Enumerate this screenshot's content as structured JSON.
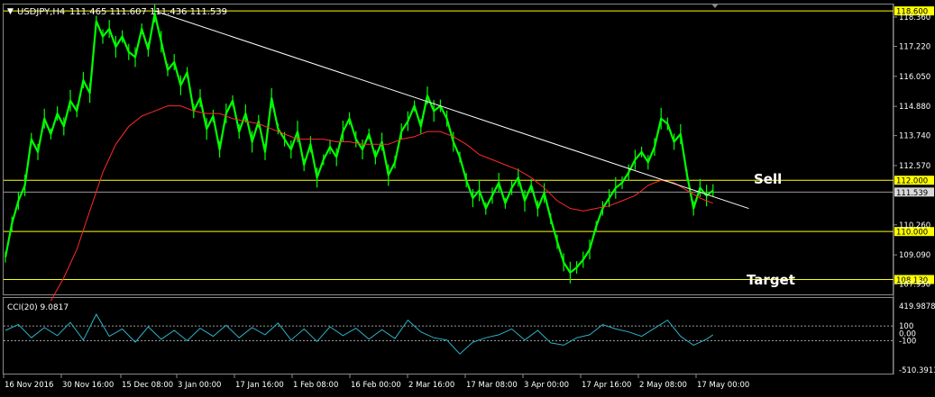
{
  "window": {
    "header_label": "USDJPY,H4",
    "ohlc": "111.465 111.607 111.436 111.539",
    "collapse_glyph": "▼"
  },
  "indicator": {
    "label": "CCI(20) 9.0817",
    "scale_labels": [
      "419.9878",
      "100",
      "0.00",
      "-100",
      "-510.3913"
    ],
    "level_upper": 100,
    "level_lower": -100,
    "range": [
      -510.3913,
      419.9878
    ]
  },
  "annotations": {
    "sell": "Sell",
    "target": "Target"
  },
  "colors": {
    "background": "#000000",
    "price": "#00ff00",
    "ma": "#ff2a2a",
    "trendline": "#ffffff",
    "levels": "#ffff00",
    "cci": "#2bb3c9",
    "grid_text": "#ffffff"
  },
  "chart_data": [
    {
      "type": "line",
      "symbol": "USDJPY",
      "timeframe": "H4",
      "ylim": [
        107.55,
        118.85
      ],
      "y_tick_labels": [
        "118.360",
        "117.220",
        "116.050",
        "114.880",
        "113.740",
        "112.570",
        "111.539",
        "110.260",
        "109.090",
        "107.950"
      ],
      "x_tick_labels": [
        "16 Nov 2016",
        "30 Nov 16:00",
        "15 Dec 08:00",
        "3 Jan 00:00",
        "17 Jan 16:00",
        "1 Feb 08:00",
        "16 Feb 00:00",
        "2 Mar 16:00",
        "17 Mar 08:00",
        "3 Apr 00:00",
        "17 Apr 16:00",
        "2 May 08:00",
        "17 May 00:00"
      ],
      "horizontal_levels": [
        {
          "label": "118.600",
          "value": 118.6
        },
        {
          "label": "112.000",
          "value": 112.0
        },
        {
          "label": "110.000",
          "value": 110.0
        },
        {
          "label": "108.130",
          "value": 108.13
        }
      ],
      "current_price_label": "111.539",
      "current_price": 111.539,
      "series": [
        {
          "points": [
            [
              0,
              109.0
            ],
            [
              2,
              110.3
            ],
            [
              4,
              111.2
            ],
            [
              6,
              111.8
            ],
            [
              8,
              113.6
            ],
            [
              10,
              113.1
            ],
            [
              12,
              114.4
            ],
            [
              14,
              113.8
            ],
            [
              16,
              114.6
            ],
            [
              18,
              114.1
            ],
            [
              20,
              115.1
            ],
            [
              22,
              114.7
            ],
            [
              24,
              115.9
            ],
            [
              26,
              115.4
            ],
            [
              28,
              118.2
            ],
            [
              30,
              117.6
            ],
            [
              32,
              117.9
            ],
            [
              34,
              117.2
            ],
            [
              36,
              117.6
            ],
            [
              38,
              117.0
            ],
            [
              40,
              116.8
            ],
            [
              42,
              117.9
            ],
            [
              44,
              117.1
            ],
            [
              46,
              118.5
            ],
            [
              48,
              117.4
            ],
            [
              50,
              116.3
            ],
            [
              52,
              116.6
            ],
            [
              54,
              115.7
            ],
            [
              56,
              116.2
            ],
            [
              58,
              114.7
            ],
            [
              60,
              115.2
            ],
            [
              62,
              114.0
            ],
            [
              64,
              114.5
            ],
            [
              66,
              113.2
            ],
            [
              68,
              114.6
            ],
            [
              70,
              115.1
            ],
            [
              72,
              113.9
            ],
            [
              74,
              114.6
            ],
            [
              76,
              113.5
            ],
            [
              78,
              114.3
            ],
            [
              80,
              113.1
            ],
            [
              82,
              115.2
            ],
            [
              84,
              114.0
            ],
            [
              86,
              113.6
            ],
            [
              88,
              113.2
            ],
            [
              90,
              113.9
            ],
            [
              92,
              112.6
            ],
            [
              94,
              113.4
            ],
            [
              96,
              112.1
            ],
            [
              98,
              112.8
            ],
            [
              100,
              113.3
            ],
            [
              102,
              112.9
            ],
            [
              104,
              113.9
            ],
            [
              106,
              114.4
            ],
            [
              108,
              113.6
            ],
            [
              110,
              113.2
            ],
            [
              112,
              113.8
            ],
            [
              114,
              112.9
            ],
            [
              116,
              113.5
            ],
            [
              118,
              112.2
            ],
            [
              120,
              112.7
            ],
            [
              122,
              113.9
            ],
            [
              124,
              114.3
            ],
            [
              126,
              114.9
            ],
            [
              128,
              114.1
            ],
            [
              130,
              115.3
            ],
            [
              132,
              114.7
            ],
            [
              134,
              114.9
            ],
            [
              136,
              114.4
            ],
            [
              138,
              113.5
            ],
            [
              140,
              112.9
            ],
            [
              142,
              112.0
            ],
            [
              144,
              111.3
            ],
            [
              146,
              111.6
            ],
            [
              148,
              110.9
            ],
            [
              150,
              111.4
            ],
            [
              152,
              111.9
            ],
            [
              154,
              111.1
            ],
            [
              156,
              111.7
            ],
            [
              158,
              112.1
            ],
            [
              160,
              111.2
            ],
            [
              162,
              111.8
            ],
            [
              164,
              110.9
            ],
            [
              166,
              111.5
            ],
            [
              168,
              110.5
            ],
            [
              170,
              109.6
            ],
            [
              172,
              108.8
            ],
            [
              174,
              108.4
            ],
            [
              176,
              108.6
            ],
            [
              178,
              108.9
            ],
            [
              180,
              109.3
            ],
            [
              182,
              110.2
            ],
            [
              184,
              110.9
            ],
            [
              186,
              111.3
            ],
            [
              188,
              111.7
            ],
            [
              190,
              111.9
            ],
            [
              192,
              112.3
            ],
            [
              194,
              112.8
            ],
            [
              196,
              113.1
            ],
            [
              198,
              112.7
            ],
            [
              200,
              113.3
            ],
            [
              202,
              114.4
            ],
            [
              204,
              114.2
            ],
            [
              206,
              113.5
            ],
            [
              208,
              113.8
            ],
            [
              210,
              112.2
            ],
            [
              212,
              110.9
            ],
            [
              214,
              111.7
            ],
            [
              216,
              111.4
            ],
            [
              218,
              111.6
            ]
          ]
        },
        {
          "points": [
            [
              14,
              107.3
            ],
            [
              18,
              108.2
            ],
            [
              22,
              109.3
            ],
            [
              26,
              110.8
            ],
            [
              30,
              112.3
            ],
            [
              34,
              113.4
            ],
            [
              38,
              114.1
            ],
            [
              42,
              114.5
            ],
            [
              46,
              114.7
            ],
            [
              50,
              114.9
            ],
            [
              54,
              114.9
            ],
            [
              58,
              114.7
            ],
            [
              62,
              114.6
            ],
            [
              66,
              114.6
            ],
            [
              70,
              114.4
            ],
            [
              74,
              114.3
            ],
            [
              78,
              114.2
            ],
            [
              82,
              114.0
            ],
            [
              86,
              113.8
            ],
            [
              90,
              113.6
            ],
            [
              94,
              113.6
            ],
            [
              98,
              113.6
            ],
            [
              102,
              113.5
            ],
            [
              106,
              113.5
            ],
            [
              110,
              113.4
            ],
            [
              114,
              113.4
            ],
            [
              118,
              113.4
            ],
            [
              122,
              113.6
            ],
            [
              126,
              113.7
            ],
            [
              130,
              113.9
            ],
            [
              134,
              113.9
            ],
            [
              138,
              113.7
            ],
            [
              142,
              113.4
            ],
            [
              146,
              113.0
            ],
            [
              150,
              112.8
            ],
            [
              154,
              112.6
            ],
            [
              158,
              112.4
            ],
            [
              162,
              112.1
            ],
            [
              166,
              111.7
            ],
            [
              170,
              111.2
            ],
            [
              174,
              110.9
            ],
            [
              178,
              110.8
            ],
            [
              182,
              110.9
            ],
            [
              186,
              111.0
            ],
            [
              190,
              111.2
            ],
            [
              194,
              111.4
            ],
            [
              198,
              111.8
            ],
            [
              202,
              112.0
            ],
            [
              206,
              111.9
            ],
            [
              210,
              111.6
            ],
            [
              214,
              111.3
            ],
            [
              218,
              111.1
            ]
          ]
        }
      ],
      "trendline": {
        "from": [
          46,
          118.6
        ],
        "to": [
          229,
          110.9
        ]
      }
    },
    {
      "type": "line",
      "ylim": [
        -510.3913,
        419.9878
      ],
      "series": [
        {
          "points": [
            [
              0,
              40
            ],
            [
              4,
              120
            ],
            [
              8,
              -60
            ],
            [
              12,
              80
            ],
            [
              16,
              -30
            ],
            [
              20,
              150
            ],
            [
              24,
              -90
            ],
            [
              28,
              260
            ],
            [
              32,
              -40
            ],
            [
              36,
              60
            ],
            [
              40,
              -120
            ],
            [
              44,
              90
            ],
            [
              48,
              -80
            ],
            [
              52,
              40
            ],
            [
              56,
              -100
            ],
            [
              60,
              70
            ],
            [
              64,
              -40
            ],
            [
              68,
              110
            ],
            [
              72,
              -60
            ],
            [
              76,
              80
            ],
            [
              80,
              -20
            ],
            [
              84,
              140
            ],
            [
              88,
              -90
            ],
            [
              92,
              60
            ],
            [
              96,
              -110
            ],
            [
              100,
              90
            ],
            [
              104,
              -30
            ],
            [
              108,
              70
            ],
            [
              112,
              -80
            ],
            [
              116,
              50
            ],
            [
              120,
              -70
            ],
            [
              124,
              180
            ],
            [
              128,
              20
            ],
            [
              132,
              -60
            ],
            [
              136,
              -90
            ],
            [
              140,
              -280
            ],
            [
              144,
              -120
            ],
            [
              148,
              -60
            ],
            [
              152,
              -20
            ],
            [
              156,
              60
            ],
            [
              160,
              -90
            ],
            [
              164,
              40
            ],
            [
              168,
              -130
            ],
            [
              172,
              -160
            ],
            [
              176,
              -60
            ],
            [
              180,
              -20
            ],
            [
              184,
              120
            ],
            [
              188,
              60
            ],
            [
              192,
              20
            ],
            [
              196,
              -40
            ],
            [
              200,
              70
            ],
            [
              204,
              180
            ],
            [
              208,
              -40
            ],
            [
              212,
              -160
            ],
            [
              216,
              -80
            ],
            [
              218,
              -20
            ]
          ]
        }
      ]
    }
  ]
}
